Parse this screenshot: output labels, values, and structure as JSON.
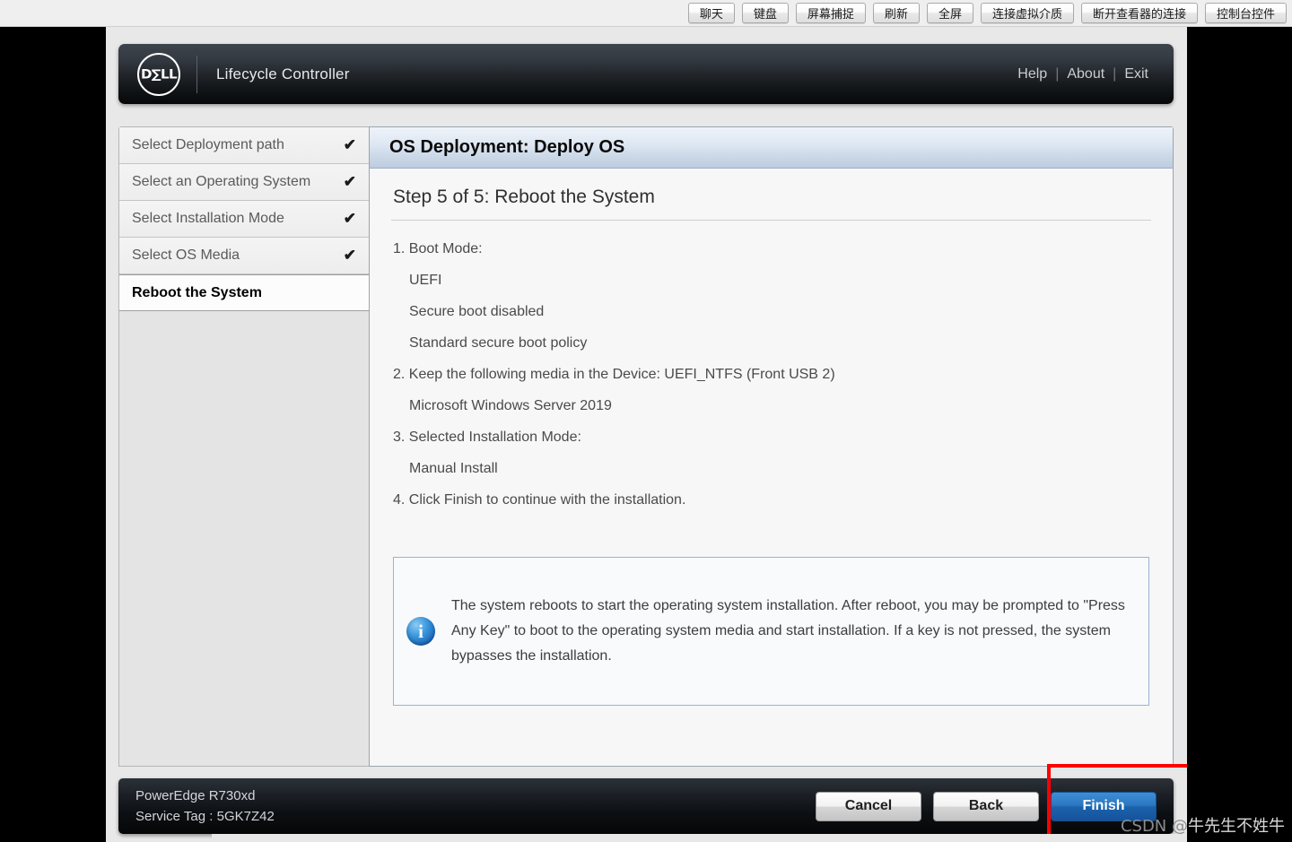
{
  "console_toolbar": {
    "buttons": [
      {
        "label": "聊天",
        "name": "chat-button"
      },
      {
        "label": "键盘",
        "name": "keyboard-button"
      },
      {
        "label": "屏幕捕捉",
        "name": "screen-capture-button"
      },
      {
        "label": "刷新",
        "name": "refresh-button"
      },
      {
        "label": "全屏",
        "name": "fullscreen-button"
      },
      {
        "label": "连接虚拟介质",
        "name": "connect-virtual-media-button"
      },
      {
        "label": "断开查看器的连接",
        "name": "disconnect-viewer-button"
      },
      {
        "label": "控制台控件",
        "name": "console-controls-button"
      }
    ]
  },
  "header": {
    "logo_text": "D∑LL",
    "title": "Lifecycle Controller",
    "links": [
      {
        "label": "Help"
      },
      {
        "label": "About"
      },
      {
        "label": "Exit"
      }
    ],
    "separator": "|"
  },
  "sidebar": {
    "items": [
      {
        "label": "Select Deployment path",
        "completed": true,
        "active": false
      },
      {
        "label": "Select an Operating System",
        "completed": true,
        "active": false
      },
      {
        "label": "Select Installation Mode",
        "completed": true,
        "active": false
      },
      {
        "label": "Select OS Media",
        "completed": true,
        "active": false
      },
      {
        "label": "Reboot the System",
        "completed": false,
        "active": true
      }
    ],
    "check_glyph": "✔"
  },
  "content": {
    "title": "OS Deployment: Deploy OS",
    "step_heading": "Step 5 of 5: Reboot the System",
    "instructions": [
      {
        "text": "1. Boot Mode:",
        "indent": false
      },
      {
        "text": "UEFI",
        "indent": true
      },
      {
        "text": "Secure boot disabled",
        "indent": true
      },
      {
        "text": "Standard secure boot policy",
        "indent": true
      },
      {
        "text": "2. Keep the following media in the Device: UEFI_NTFS (Front USB 2)",
        "indent": false
      },
      {
        "text": "Microsoft Windows Server 2019",
        "indent": true
      },
      {
        "text": "3. Selected Installation Mode:",
        "indent": false
      },
      {
        "text": "Manual Install",
        "indent": true
      },
      {
        "text": "4. Click Finish to continue with the installation.",
        "indent": false
      }
    ],
    "info_box": {
      "icon": "info-icon",
      "glyph": "i",
      "text": "The system reboots to start the operating system installation. After reboot, you may be prompted to \"Press Any Key\" to boot to the operating system media and start installation. If a key is not pressed, the system bypasses the installation."
    }
  },
  "footer": {
    "model": "PowerEdge R730xd",
    "service_tag": "Service Tag : 5GK7Z42",
    "buttons": [
      {
        "label": "Cancel",
        "name": "cancel-button",
        "primary": false
      },
      {
        "label": "Back",
        "name": "back-button",
        "primary": false
      },
      {
        "label": "Finish",
        "name": "finish-button",
        "primary": true
      }
    ]
  },
  "watermark": {
    "prefix": "CSDN @",
    "author": "牛先生不姓牛"
  },
  "colors": {
    "accent_blue": "#1b62ad",
    "highlight_red": "#ff0000",
    "header_dark": "#14171a",
    "title_bar": "#ccd9e8"
  }
}
